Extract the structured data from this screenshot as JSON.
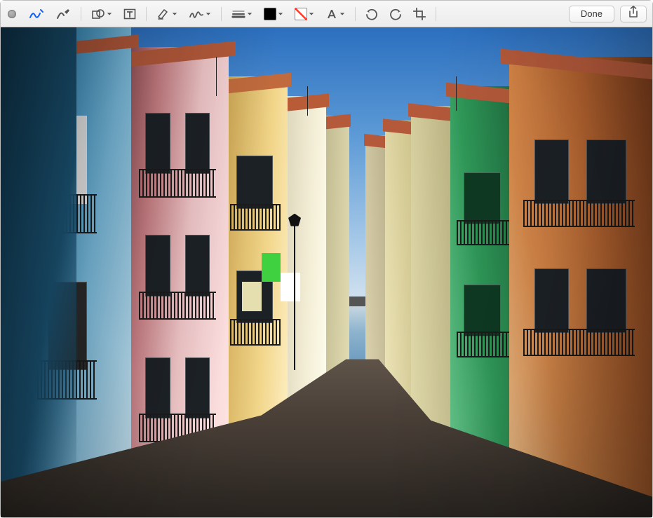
{
  "toolbar": {
    "done_label": "Done",
    "tools": {
      "sketch": "sketch",
      "draw": "draw",
      "shapes": "shapes",
      "text": "text",
      "highlight": "highlight",
      "sign": "sign",
      "line_style": "line-style",
      "border_color": "border-color",
      "fill_color": "fill-color",
      "text_style": "text-style",
      "rotate_left": "rotate-left",
      "rotate_right": "rotate-right",
      "crop": "crop",
      "share": "share"
    },
    "colors": {
      "border_hex": "#000000",
      "fill_hex": "#ffffff",
      "fill_none": true,
      "active_tool_color": "#0a60ff"
    }
  },
  "image": {
    "description": "Narrow sunlit European street with colorful building facades (blue, pink, yellow, cream, green, orange), wrought-iron balconies, terracotta roof eaves, hanging laundry, TV antennas, a street lamp, distant rooftops and a strip of sea under a clear blue sky."
  }
}
